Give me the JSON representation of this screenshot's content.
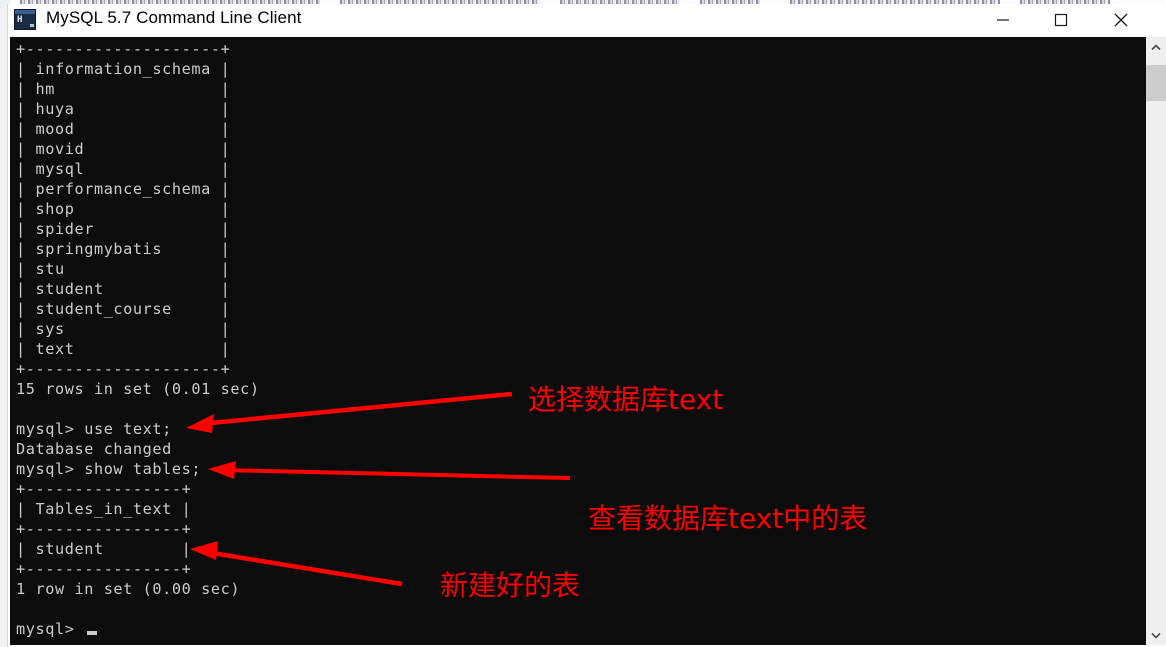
{
  "window": {
    "title": "MySQL 5.7 Command Line Client",
    "icon": "mysql-console-icon",
    "icon_glyph": "H",
    "controls": {
      "minimize": "minimize-icon",
      "maximize": "maximize-icon",
      "close": "close-icon"
    }
  },
  "scrollbar": {
    "up": "chevron-up-icon",
    "down": "chevron-down-icon"
  },
  "terminal": {
    "prompt": "mysql>",
    "background": "#0c0c0c",
    "foreground": "#cccccc",
    "content": "+--------------------+\n| information_schema |\n| hm                 |\n| huya               |\n| mood               |\n| movid              |\n| mysql              |\n| performance_schema |\n| shop               |\n| spider             |\n| springmybatis      |\n| stu                |\n| student            |\n| student_course     |\n| sys                |\n| text               |\n+--------------------+\n15 rows in set (0.01 sec)\n\nmysql> use text;\nDatabase changed\nmysql> show tables;\n+----------------+\n| Tables_in_text |\n+----------------+\n| student        |\n+----------------+\n1 row in set (0.00 sec)\n\nmysql>",
    "databases": [
      "information_schema",
      "hm",
      "huya",
      "mood",
      "movid",
      "mysql",
      "performance_schema",
      "shop",
      "spider",
      "springmybatis",
      "stu",
      "student",
      "student_course",
      "sys",
      "text"
    ],
    "databases_result": "15 rows in set (0.01 sec)",
    "commands": [
      "use text;",
      "show tables;"
    ],
    "use_response": "Database changed",
    "tables_column_header": "Tables_in_text",
    "tables": [
      "student"
    ],
    "tables_result": "1 row in set (0.00 sec)"
  },
  "annotations": {
    "color": "#ff0000",
    "items": [
      {
        "text": "选择数据库text"
      },
      {
        "text": "查看数据库text中的表"
      },
      {
        "text": "新建好的表"
      }
    ]
  }
}
